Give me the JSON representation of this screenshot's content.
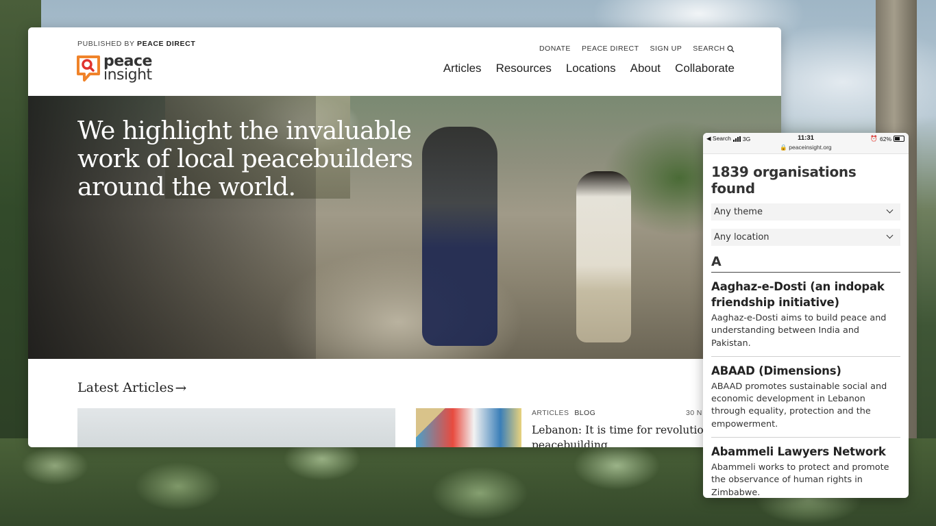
{
  "site": {
    "published_prefix": "PUBLISHED BY",
    "published_by": "PEACE DIRECT",
    "logo_line1": "peace",
    "logo_line2": "insight",
    "utility_nav": [
      "DONATE",
      "PEACE DIRECT",
      "SIGN UP",
      "SEARCH"
    ],
    "main_nav": [
      "Articles",
      "Resources",
      "Locations",
      "About",
      "Collaborate"
    ],
    "hero_title": "We highlight the invaluable work of local peacebuilders around the world.",
    "latest_heading": "Latest Articles",
    "latest_arrow": "→",
    "article": {
      "tags": [
        "ARTICLES",
        "BLOG"
      ],
      "date": "30 N",
      "title": "Lebanon: It is time for revolutionary peacebuilding"
    }
  },
  "phone": {
    "status": {
      "back": "◀ Search",
      "network": "3G",
      "time": "11:31",
      "battery": "62%",
      "url": "peaceinsight.org"
    },
    "results_heading": "1839 organisations found",
    "theme_select": "Any theme",
    "location_select": "Any location",
    "letter": "A",
    "organisations": [
      {
        "name": "Aaghaz-e-Dosti (an indopak friendship initiative)",
        "description": "Aaghaz-e-Dosti aims to build peace and understanding between India and Pakistan."
      },
      {
        "name": "ABAAD (Dimensions)",
        "description": "ABAAD promotes sustainable social and economic development in Lebanon through equality, protection and the empowerment."
      },
      {
        "name": "Abammeli Lawyers Network",
        "description": "Abammeli works to protect and promote the observance of human rights in Zimbabwe."
      }
    ]
  },
  "colors": {
    "logo_orange": "#f0832a",
    "logo_red": "#e0332f",
    "text_dark": "#222222"
  },
  "icons": [
    "search-icon",
    "chevron-down-icon",
    "lock-icon",
    "signal-icon",
    "battery-icon",
    "alarm-icon",
    "arrow-right-icon"
  ]
}
